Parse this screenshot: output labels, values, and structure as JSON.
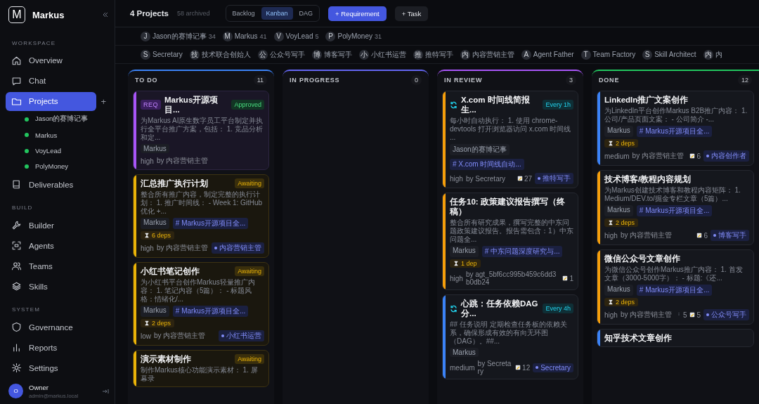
{
  "sidebar": {
    "brand": "Markus",
    "logo": "M",
    "sections": [
      {
        "label": "WORKSPACE",
        "items": [
          {
            "label": "Overview",
            "selected": false
          },
          {
            "label": "Chat",
            "selected": false
          },
          {
            "label": "Projects",
            "selected": true,
            "add": "+",
            "children": [
              {
                "label": "Jason的赛博记事",
                "color": "#22c55e"
              },
              {
                "label": "Markus",
                "color": "#22c55e"
              },
              {
                "label": "VoyLead",
                "color": "#22c55e"
              },
              {
                "label": "PolyMoney",
                "color": "#22c55e"
              }
            ]
          },
          {
            "label": "Deliverables",
            "selected": false
          }
        ]
      },
      {
        "label": "BUILD",
        "items": [
          {
            "label": "Builder",
            "selected": false
          },
          {
            "label": "Agents",
            "selected": false
          },
          {
            "label": "Teams",
            "selected": false
          },
          {
            "label": "Skills",
            "selected": false
          }
        ]
      },
      {
        "label": "SYSTEM",
        "items": [
          {
            "label": "Governance",
            "selected": false
          },
          {
            "label": "Reports",
            "selected": false
          },
          {
            "label": "Settings",
            "selected": false
          }
        ]
      }
    ],
    "user": {
      "initial": "O",
      "name": "Owner",
      "email": "admin@markus.local"
    }
  },
  "toolbar": {
    "title": "4 Projects",
    "archived": "58 archived",
    "views": [
      {
        "label": "Backlog",
        "selected": false
      },
      {
        "label": "Kanban",
        "selected": true
      },
      {
        "label": "DAG",
        "selected": false
      }
    ],
    "buttons": [
      {
        "label": "+ Requirement",
        "kind": "primary"
      },
      {
        "label": "+ Task",
        "kind": "secondary"
      }
    ]
  },
  "project_filters": [
    {
      "initial": "J",
      "name": "Jason的赛博记事",
      "count": "34"
    },
    {
      "initial": "M",
      "name": "Markus",
      "count": "41"
    },
    {
      "initial": "V",
      "name": "VoyLead",
      "count": "5"
    },
    {
      "initial": "P",
      "name": "PolyMoney",
      "count": "31"
    }
  ],
  "agent_filters": [
    {
      "initial": "S",
      "name": "Secretary"
    },
    {
      "initial": "技",
      "name": "技术联合创始人"
    },
    {
      "initial": "公",
      "name": "公众号写手"
    },
    {
      "initial": "博",
      "name": "博客写手"
    },
    {
      "initial": "小",
      "name": "小红书运营"
    },
    {
      "initial": "推",
      "name": "推特写手"
    },
    {
      "initial": "内",
      "name": "内容营销主管"
    },
    {
      "initial": "A",
      "name": "Agent Father"
    },
    {
      "initial": "T",
      "name": "Team Factory"
    },
    {
      "initial": "S",
      "name": "Skill Architect"
    },
    {
      "initial": "内",
      "name": "内"
    }
  ],
  "columns": [
    {
      "title": "TO DO",
      "count": "11",
      "color": "#3b82f6",
      "cards": [
        {
          "kind": "requirement",
          "tag": "REQ",
          "color": "#a855f7",
          "title": "Markus开源项目...",
          "status": {
            "text": "Approved",
            "kind": "approved"
          },
          "description": "为Markus AI原生数字员工平台制定并执行全平台推广方案，包括： 1. 竞品分析和定...",
          "project": "Markus",
          "priority": "high",
          "by": "by 内容营销主管"
        },
        {
          "kind": "task",
          "color": "#eab308",
          "title": "汇总推广执行计划",
          "status": {
            "text": "Awaiting",
            "kind": "awaiting"
          },
          "description": "整合所有推广内容，制定完整的执行计划： 1. 推广时间线： - Week 1: GitHub优化 +...",
          "project": "Markus",
          "epic": "# Markus开源项目全...",
          "deps": "6 deps",
          "priority": "high",
          "by": "by 内容营销主管",
          "assignee": "内容营销主管"
        },
        {
          "kind": "task",
          "color": "#eab308",
          "title": "小红书笔记创作",
          "status": {
            "text": "Awaiting",
            "kind": "awaiting"
          },
          "description": "为小红书平台创作Markus轻量推广内容： 1. 笔记内容（5篇）： - 标题风格：情绪化/...",
          "project": "Markus",
          "epic": "# Markus开源项目全...",
          "deps": "2 deps",
          "priority": "low",
          "by": "by 内容营销主管",
          "assignee": "小红书运营"
        },
        {
          "kind": "task",
          "color": "#eab308",
          "title": "演示素材制作",
          "status": {
            "text": "Awaiting",
            "kind": "awaiting"
          },
          "description": "制作Markus核心功能演示素材： 1. 屏幕录"
        }
      ]
    },
    {
      "title": "IN PROGRESS",
      "count": "0",
      "color": "#6366f1"
    },
    {
      "title": "IN REVIEW",
      "count": "3",
      "color": "#a855f7",
      "cards": [
        {
          "kind": "recurring",
          "color": "#f59e0b",
          "title": "X.com 时间线简报生...",
          "status": {
            "text": "Every 1h",
            "kind": "schedule"
          },
          "description": "每小时自动执行： 1. 使用 chrome-devtools 打开浏览器访问 x.com 时间线 ...",
          "project": "Jason的赛博记事",
          "epic": "# X.com 时间线自动...",
          "priority": "high",
          "by": "by Secretary",
          "notes": "27",
          "assignee": "推特写手"
        },
        {
          "kind": "task",
          "color": "#f59e0b",
          "title": "任务10: 政策建议报告撰写（终稿）",
          "description": "整合所有研究成果，撰写完整的中东问题政策建议报告。报告需包含：1）中东问题全...",
          "project": "Markus",
          "epic": "# 中东问题深度研究与...",
          "deps": "1 dep",
          "priority": "high",
          "by": "by agt_5bf6cc995b459c6dd3b0db24",
          "notes": "1"
        },
        {
          "kind": "recurring",
          "color": "#3b82f6",
          "title": "心跳：任务依赖DAG分...",
          "status": {
            "text": "Every 4h",
            "kind": "schedule"
          },
          "description": "## 任务说明 定期检查任务板的依赖关系，确保形成有效的有向无环图（DAG）。##...",
          "project": "Markus",
          "priority": "medium",
          "by": "by Secretary",
          "notes": "12",
          "assignee": "Secretary"
        }
      ]
    },
    {
      "title": "DONE",
      "count": "12",
      "color": "#22c55e",
      "cards": [
        {
          "kind": "task",
          "color": "#3b82f6",
          "title": "LinkedIn推广文案创作",
          "description": "为LinkedIn平台创作Markus B2B推广内容： 1. 公司/产品页面文案： - 公司简介 -...",
          "project": "Markus",
          "epic": "# Markus开源项目全...",
          "deps": "2 deps",
          "priority": "medium",
          "by": "by 内容营销主管",
          "notes": "6",
          "assignee": "内容创作者"
        },
        {
          "kind": "task",
          "color": "#f59e0b",
          "title": "技术博客/教程内容规划",
          "description": "为Markus创建技术博客和教程内容矩阵： 1. Medium/DEV.to/掘金专栏文章（5篇）...",
          "project": "Markus",
          "epic": "# Markus开源项目全...",
          "deps": "2 deps",
          "priority": "high",
          "by": "by 内容营销主管",
          "notes": "6",
          "assignee": "博客写手"
        },
        {
          "kind": "task",
          "color": "#f59e0b",
          "title": "微信公众号文章创作",
          "description": "为微信公众号创作Markus推广内容： 1. 首发文章（3000-5000字）： - 标题:《还...",
          "project": "Markus",
          "epic": "# Markus开源项目全...",
          "deps": "2 deps",
          "priority": "high",
          "by": "by 内容营销主管",
          "subtasks": "5",
          "notes": "5",
          "assignee": "公众号写手"
        },
        {
          "kind": "task",
          "color": "#3b82f6",
          "title": "知乎技术文章创作"
        }
      ]
    }
  ]
}
